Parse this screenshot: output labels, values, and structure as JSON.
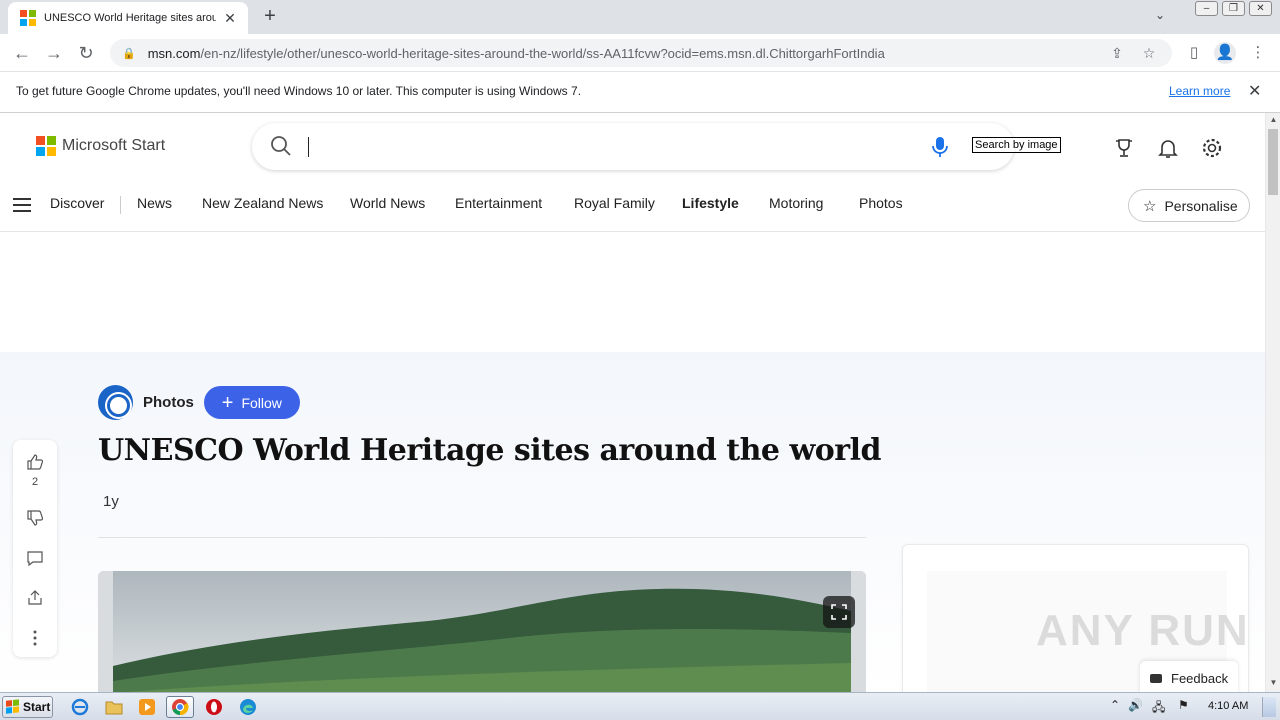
{
  "browser": {
    "tab_title": "UNESCO World Heritage sites around the world",
    "new_tab": "+",
    "url_host": "msn.com",
    "url_path": "/en-nz/lifestyle/other/unesco-world-heritage-sites-around-the-world/ss-AA11fcvw?ocid=ems.msn.dl.ChittorgarhFortIndia",
    "infobar_message": "To get future Google Chrome updates, you'll need Windows 10 or later. This computer is using Windows 7.",
    "infobar_link": "Learn more"
  },
  "msn": {
    "logo_text": "Microsoft Start",
    "search_by_image_tip": "Search by image",
    "nav": [
      "Discover",
      "News",
      "New Zealand News",
      "World News",
      "Entertainment",
      "Royal Family",
      "Lifestyle",
      "Motoring",
      "Photos"
    ],
    "active_nav": "Lifestyle",
    "personalise": "Personalise"
  },
  "article": {
    "provider": "Photos",
    "follow": "Follow",
    "headline": "UNESCO World Heritage sites around the world",
    "age": "1y",
    "like_count": "2"
  },
  "feedback": "Feedback",
  "watermark": "ANY RUN",
  "taskbar": {
    "start": "Start",
    "clock": "4:10 AM"
  },
  "colors": {
    "follow_button": "#3c62e8",
    "chrome_tabstrip": "#dee1e6",
    "link": "#1a73e8"
  }
}
